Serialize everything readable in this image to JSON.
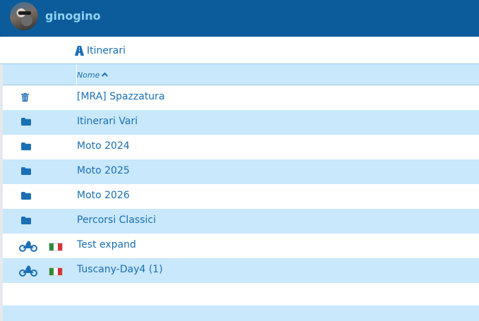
{
  "header": {
    "username": "ginogino"
  },
  "breadcrumb": {
    "label": "Itinerari"
  },
  "table": {
    "column_name": "Nome",
    "sort": "ascending",
    "rows": [
      {
        "icon": "trash-icon",
        "label": "[MRA] Spazzatura"
      },
      {
        "icon": "folder-icon",
        "label": "Itinerari Vari"
      },
      {
        "icon": "folder-icon",
        "label": "Moto 2024"
      },
      {
        "icon": "folder-icon",
        "label": "Moto 2025"
      },
      {
        "icon": "folder-icon",
        "label": "Moto 2026"
      },
      {
        "icon": "folder-icon",
        "label": "Percorsi Classici"
      },
      {
        "icon": "motorcycle-icon",
        "flag": "italy-flag-icon",
        "label": "Test expand"
      },
      {
        "icon": "motorcycle-icon",
        "flag": "italy-flag-icon",
        "label": "Tuscany-Day4 (1)"
      }
    ]
  },
  "colors": {
    "header_bg": "#0c5b9a",
    "username": "#8fd2f5",
    "accent": "#1a6fb5",
    "row_alt": "#c9e8fb"
  }
}
